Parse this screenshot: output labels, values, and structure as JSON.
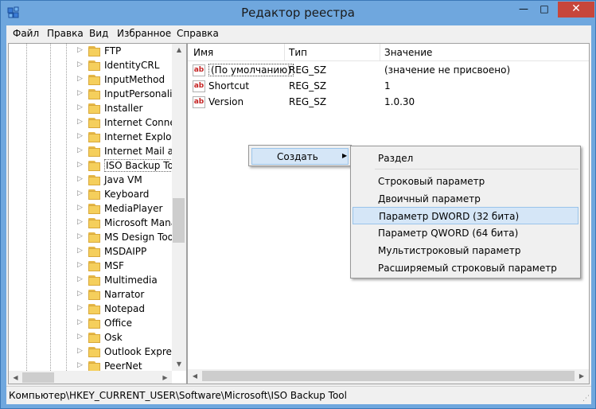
{
  "window": {
    "title": "Редактор реестра",
    "minimize": "—",
    "maximize": "□",
    "close": "✕"
  },
  "menubar": [
    "Файл",
    "Правка",
    "Вид",
    "Избранное",
    "Справка"
  ],
  "tree": {
    "items": [
      {
        "label": "FTP"
      },
      {
        "label": "IdentityCRL"
      },
      {
        "label": "InputMethod"
      },
      {
        "label": "InputPersonaliz"
      },
      {
        "label": "Installer"
      },
      {
        "label": "Internet Connec"
      },
      {
        "label": "Internet Explore"
      },
      {
        "label": "Internet Mail an"
      },
      {
        "label": "ISO Backup Too",
        "selected": true
      },
      {
        "label": "Java VM"
      },
      {
        "label": "Keyboard"
      },
      {
        "label": "MediaPlayer"
      },
      {
        "label": "Microsoft Mana"
      },
      {
        "label": "MS Design Tool"
      },
      {
        "label": "MSDAIPP"
      },
      {
        "label": "MSF"
      },
      {
        "label": "Multimedia"
      },
      {
        "label": "Narrator"
      },
      {
        "label": "Notepad"
      },
      {
        "label": "Office"
      },
      {
        "label": "Osk"
      },
      {
        "label": "Outlook Express"
      },
      {
        "label": "PeerNet"
      }
    ],
    "expander_glyph": "▷",
    "scroll_position": 0.55
  },
  "list": {
    "columns": [
      "Имя",
      "Тип",
      "Значение"
    ],
    "rows": [
      {
        "icon": "ab",
        "name": "(По умолчанию)",
        "type": "REG_SZ",
        "value": "(значение не присвоено)"
      },
      {
        "icon": "ab",
        "name": "Shortcut",
        "type": "REG_SZ",
        "value": "1"
      },
      {
        "icon": "ab",
        "name": "Version",
        "type": "REG_SZ",
        "value": "1.0.30"
      }
    ]
  },
  "context_menu": {
    "item": "Создать",
    "arrow": "▶"
  },
  "submenu": {
    "items": [
      "Раздел",
      "Строковый параметр",
      "Двоичный параметр",
      "Параметр DWORD (32 бита)",
      "Параметр QWORD (64 бита)",
      "Мультистроковый параметр",
      "Расширяемый строковый параметр"
    ],
    "hovered": "Параметр DWORD (32 бита)"
  },
  "statusbar": {
    "path": "Компьютер\\HKEY_CURRENT_USER\\Software\\Microsoft\\ISO Backup Tool"
  },
  "colors": {
    "titlebar": "#6fa7de",
    "close_button": "#c7463b",
    "highlight": "#d5e6f7",
    "folder": "#f5cf5c",
    "string_icon": "#c42222"
  }
}
